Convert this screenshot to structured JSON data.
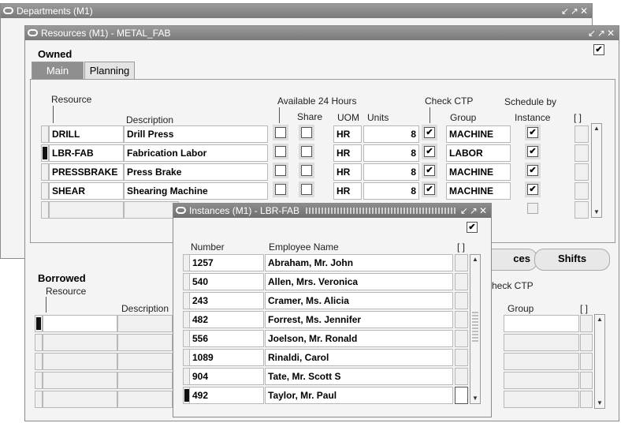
{
  "departments": {
    "title": "Departments (M1)",
    "controls": "↙↗✕"
  },
  "resources": {
    "title": "Resources (M1) - METAL_FAB",
    "controls": "↙↗✕",
    "owned_label": "Owned",
    "tabs": [
      "Main",
      "Planning"
    ],
    "headers": {
      "resource": "Resource",
      "description": "Description",
      "available": "Available 24 Hours",
      "share": "Share",
      "uom": "UOM",
      "units": "Units",
      "check_ctp": "Check CTP",
      "group": "Group",
      "schedule_by": "Schedule by",
      "instance": "Instance",
      "brackets": "[ ]"
    },
    "rows": [
      {
        "resource": "DRILL",
        "description": "Drill Press",
        "uom": "HR",
        "units": "8",
        "ctp": true,
        "group": "MACHINE",
        "instance": true
      },
      {
        "resource": "LBR-FAB",
        "description": "Fabrication Labor",
        "uom": "HR",
        "units": "8",
        "ctp": true,
        "group": "LABOR",
        "instance": true
      },
      {
        "resource": "PRESSBRAKE",
        "description": "Press Brake",
        "uom": "HR",
        "units": "8",
        "ctp": true,
        "group": "MACHINE",
        "instance": true
      },
      {
        "resource": "SHEAR",
        "description": "Shearing Machine",
        "uom": "HR",
        "units": "8",
        "ctp": true,
        "group": "MACHINE",
        "instance": true
      }
    ],
    "buttons": {
      "instances_partial": "ces",
      "shifts": "Shifts"
    },
    "borrowed": {
      "label": "Borrowed",
      "resource": "Resource",
      "description": "Description",
      "check_ctp_partial": "heck CTP",
      "group": "Group",
      "brackets": "[ ]"
    }
  },
  "instances": {
    "title": "Instances (M1) - LBR-FAB",
    "controls": "↙↗✕",
    "headers": {
      "number": "Number",
      "employee_name": "Employee Name",
      "brackets": "[ ]"
    },
    "rows": [
      {
        "number": "1257",
        "name": "Abraham, Mr. John"
      },
      {
        "number": "540",
        "name": "Allen, Mrs. Veronica"
      },
      {
        "number": "243",
        "name": "Cramer, Ms. Alicia"
      },
      {
        "number": "482",
        "name": "Forrest, Ms. Jennifer"
      },
      {
        "number": "556",
        "name": "Joelson, Mr. Ronald"
      },
      {
        "number": "1089",
        "name": "Rinaldi, Carol"
      },
      {
        "number": "904",
        "name": "Tate, Mr. Scott S"
      },
      {
        "number": "492",
        "name": "Taylor, Mr. Paul"
      }
    ]
  },
  "checkmark": "✔"
}
